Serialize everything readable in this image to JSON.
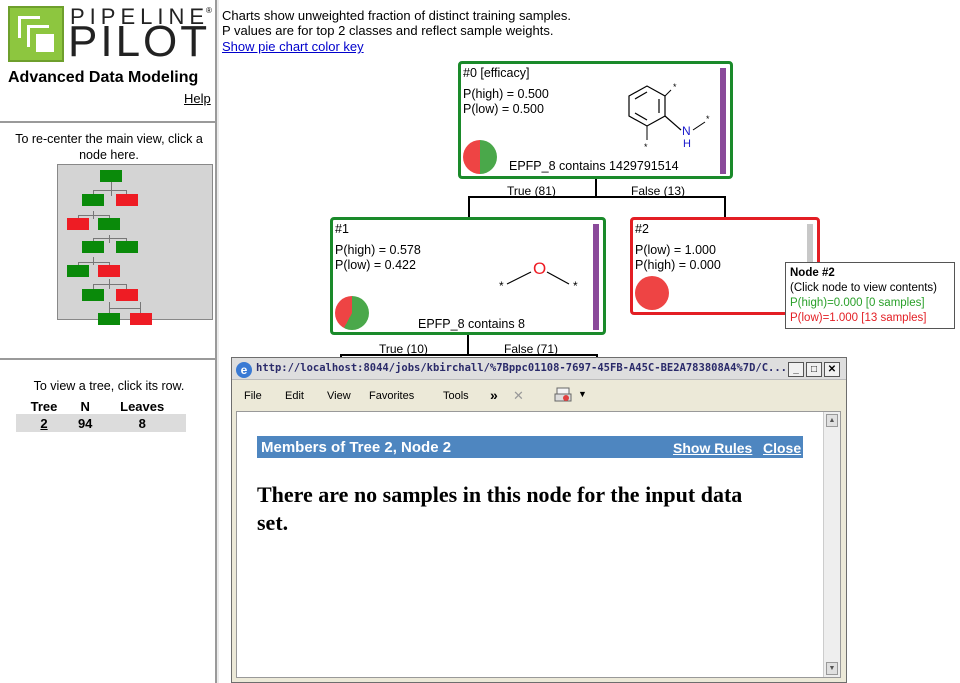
{
  "sidebar": {
    "logo_top": "PIPELINE",
    "logo_bottom": "PILOT",
    "logo_reg": "®",
    "app_title": "Advanced Data Modeling",
    "help_link": "Help",
    "recenter_text": "To re-center the main view, click a node here.",
    "view_tree_text": "To view a tree, click its row.",
    "table": {
      "headers": [
        "Tree",
        "N",
        "Leaves"
      ],
      "rows": [
        {
          "tree": "2",
          "n": "94",
          "leaves": "8"
        }
      ]
    }
  },
  "main": {
    "note1": "Charts show unweighted fraction of distinct training samples.",
    "note2": "P values are for top 2 classes and reflect sample weights.",
    "pie_key_link": "Show pie chart color key",
    "nodes": [
      {
        "id": "#0 [efficacy]",
        "p1": "P(high) = 0.500",
        "p2": "P(low) = 0.500",
        "rule": "EPFP_8 contains 1429791514",
        "green_fraction": 0.5
      },
      {
        "id": "#1",
        "p1": "P(high) = 0.578",
        "p2": "P(low) = 0.422",
        "rule": "EPFP_8 contains 8",
        "green_fraction": 0.578
      },
      {
        "id": "#2",
        "p1": "P(low) = 1.000",
        "p2": "P(high) = 0.000",
        "green_fraction": 0.0
      }
    ],
    "edges": {
      "n0_true": "True (81)",
      "n0_false": "False (13)",
      "n1_true": "True (10)",
      "n1_false": "False (71)"
    },
    "molecule_labels": {
      "n_label": "N",
      "h_label": "H",
      "o_label": "O",
      "star": "*"
    },
    "colors": {
      "high": "#4aa84a",
      "low": "#ee4444",
      "green_border": "#1a8a2a",
      "red_border": "#e31e24"
    }
  },
  "tooltip": {
    "title": "Node #2",
    "subtitle": "(Click node to view contents)",
    "high": "P(high)=0.000 [0 samples]",
    "low": "P(low)=1.000 [13 samples]"
  },
  "popup": {
    "url": "http://localhost:8044/jobs/kbirchall/%7Bppc01108-7697-45FB-A45C-BE2A783808A4%7D/C...",
    "menu": [
      "File",
      "Edit",
      "View",
      "Favorites",
      "Tools"
    ],
    "menu_more": "»",
    "menu_close": "✕",
    "window_buttons": {
      "min": "_",
      "max": "□",
      "close": "✕"
    },
    "header_title": "Members of Tree 2, Node 2",
    "show_rules": "Show Rules",
    "close_link": "Close",
    "message": "There are no samples in this node for the input data set."
  }
}
